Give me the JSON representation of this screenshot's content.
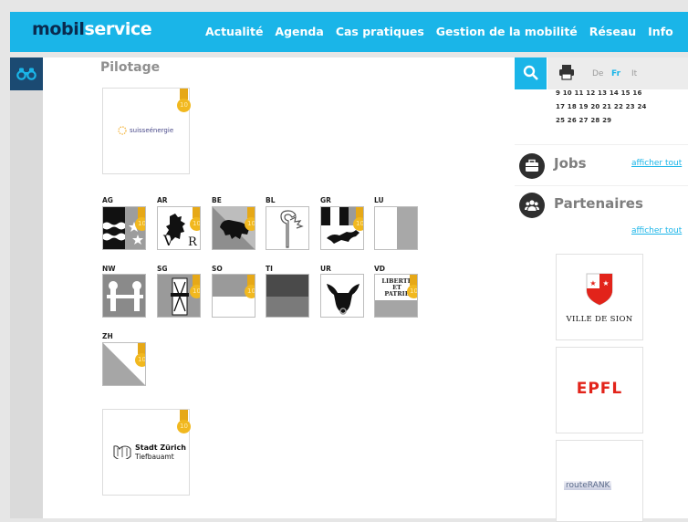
{
  "header": {
    "logo_part1": "mobil",
    "logo_part2": "service",
    "nav": [
      "Actualité",
      "Agenda",
      "Cas pratiques",
      "Gestion de la mobilité",
      "Réseau",
      "Info"
    ]
  },
  "main": {
    "section_title": "Pilotage",
    "top_card_logo": "suisseénergie",
    "badge_value": "10",
    "cantons": [
      "AG",
      "AR",
      "BE",
      "BL",
      "GR",
      "LU",
      "NW",
      "SG",
      "SO",
      "TI",
      "UR",
      "VD",
      "ZH"
    ],
    "city_card": {
      "title": "Stadt Zürich",
      "subtitle": "Tiefbauamt"
    },
    "vd_motto": [
      "LIBERTÉ",
      "ET",
      "PATRIE"
    ]
  },
  "sidebar": {
    "languages": [
      "De",
      "Fr",
      "It"
    ],
    "active_language": "Fr",
    "calendar_rows": [
      "9 10 11 12 13 14 15 16",
      "17 18 19 20 21 22 23 24",
      "25 26 27 28 29"
    ],
    "jobs": {
      "title": "Jobs",
      "link": "afficher tout"
    },
    "partners": {
      "title": "Partenaires",
      "link": "afficher tout",
      "items": [
        "VILLE DE SION",
        "EPFL",
        "routeRANK"
      ]
    }
  },
  "colors": {
    "accent": "#1ab5e8",
    "navy": "#1b4a72",
    "badge": "#f1b81f",
    "epfl_red": "#e2231a"
  }
}
